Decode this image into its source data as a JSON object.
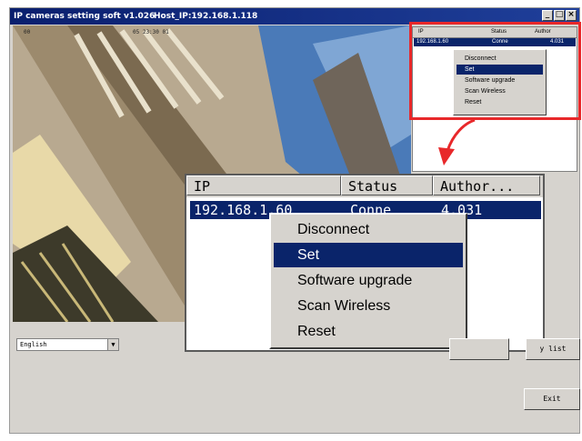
{
  "window": {
    "title": "IP cameras setting soft v1.026",
    "host": "Host_IP:192.168.1.118",
    "controls": [
      "_",
      "□",
      "×"
    ]
  },
  "video": {
    "osd_left": "00",
    "osd_right": "05 23:30 01"
  },
  "small_list": {
    "headers": [
      "IP",
      "Status",
      "Author"
    ],
    "row": {
      "ip": "192.168.1.60",
      "status": "Conne",
      "author": "4.031"
    },
    "menu": [
      "Disconnect",
      "Set",
      "Software upgrade",
      "Scan Wireless",
      "Reset"
    ],
    "selected_index": 1
  },
  "zoom_list": {
    "headers": [
      "IP",
      "Status",
      "Author..."
    ],
    "row": {
      "ip": "192.168.1.60",
      "status": "Conne",
      "author": "4.031"
    },
    "menu": [
      "Disconnect",
      "Set",
      "Software upgrade",
      "Scan Wireless",
      "Reset"
    ],
    "selected_index": 1
  },
  "language": {
    "value": "English"
  },
  "buttons": {
    "refresh_list": "y list",
    "exit": "Exit"
  },
  "colors": {
    "highlight": "#0a246a",
    "callout": "#e8282a",
    "face": "#d6d3ce"
  }
}
